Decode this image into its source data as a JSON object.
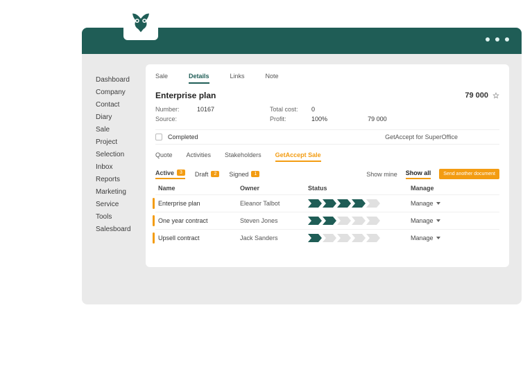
{
  "sidebar": {
    "items": [
      "Dashboard",
      "Company",
      "Contact",
      "Diary",
      "Sale",
      "Project",
      "Selection",
      "Inbox",
      "Reports",
      "Marketing",
      "Service",
      "Tools",
      "Salesboard"
    ]
  },
  "topTabs": {
    "items": [
      "Sale",
      "Details",
      "Links",
      "Note"
    ],
    "activeIndex": 1
  },
  "title": "Enterprise plan",
  "amount": "79 000",
  "fieldsLeft": [
    {
      "label": "Number:",
      "value": "10167"
    },
    {
      "label": "Source:",
      "value": ""
    }
  ],
  "fieldsRight": [
    {
      "label": "Total cost:",
      "value": "0"
    },
    {
      "label": "Profit:",
      "value": "100%",
      "extra": "79 000"
    }
  ],
  "completed": {
    "label": "Completed",
    "right": "GetAccept for SuperOffice"
  },
  "subTabs": {
    "items": [
      "Quote",
      "Activities",
      "Stakeholders",
      "GetAccept Sale"
    ],
    "activeIndex": 3
  },
  "filters": [
    {
      "label": "Active",
      "count": "3"
    },
    {
      "label": "Draft",
      "count": "2"
    },
    {
      "label": "Signed",
      "count": "1"
    }
  ],
  "filterActiveIndex": 0,
  "showMine": "Show mine",
  "showAll": "Show all",
  "sendBtn": "Send another document",
  "columns": [
    "Name",
    "Owner",
    "Status",
    "Manage"
  ],
  "rows": [
    {
      "name": "Enterprise plan",
      "owner": "Eleanor Talbot",
      "progress": 4,
      "manage": "Manage"
    },
    {
      "name": "One year contract",
      "owner": "Steven Jones",
      "progress": 2,
      "manage": "Manage"
    },
    {
      "name": "Upsell contract",
      "owner": "Jack Sanders",
      "progress": 1,
      "manage": "Manage"
    }
  ]
}
